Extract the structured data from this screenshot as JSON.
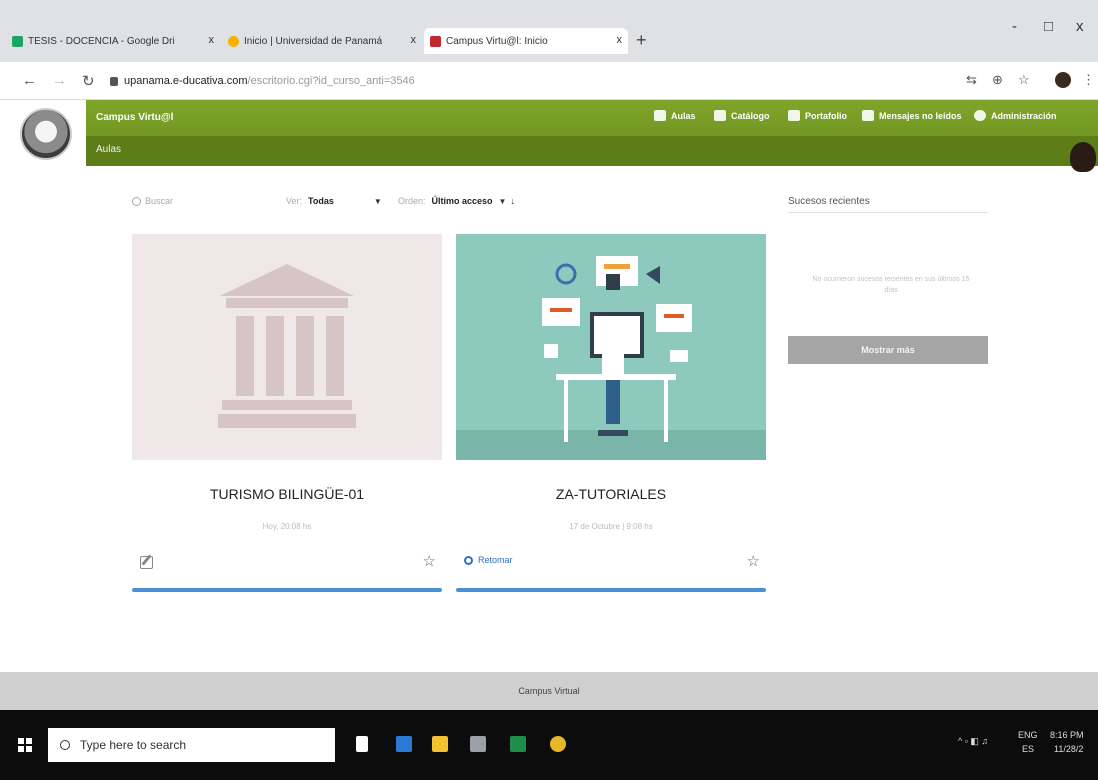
{
  "browser": {
    "tabs": [
      {
        "title": "TESIS - DOCENCIA - Google Dri",
        "favicon_color": "#1fa463"
      },
      {
        "title": "Inicio | Universidad de Panamá",
        "favicon_color": "#f4b400"
      },
      {
        "title": "Campus Virtu@l: Inicio",
        "favicon_color": "#c2272d"
      }
    ],
    "close_glyph": "x",
    "new_tab_glyph": "+",
    "window_controls": {
      "minimize": "-",
      "maximize": "□",
      "close": "x"
    },
    "url_host": "upanama.e-ducativa.com",
    "url_path": "/escritorio.cgi?id_curso_anti=3546"
  },
  "campus": {
    "brand": "Campus Virtu@l",
    "breadcrumb": "Aulas",
    "nav": [
      "Aulas",
      "Catálogo",
      "Portafolio",
      "Mensajes no leídos",
      "Administración"
    ],
    "accent_color": "#6f931f"
  },
  "filters": {
    "search_placeholder": "Buscar",
    "view_label": "Ver:",
    "view_value": "Todas",
    "order_label": "Orden:",
    "order_value": "Último acceso",
    "order_arrow": "↓"
  },
  "courses": [
    {
      "title": "TURISMO BILINGÜE-01",
      "meta": "Hoy, 20:08 hs"
    },
    {
      "title": "ZA-TUTORIALES",
      "meta": "17 de Octubre | 9:08 hs",
      "action": "Retomar"
    }
  ],
  "sidebar": {
    "title": "Sucesos recientes",
    "empty_text": "No ocurrieron sucesos recientes en sus últimos 15 días",
    "button": "Mostrar más"
  },
  "footer": "Campus Virtual",
  "taskbar": {
    "search_placeholder": "Type here to search",
    "lang": "ENG",
    "region": "ES",
    "time": "8:16 PM",
    "date": "11/28/2"
  }
}
